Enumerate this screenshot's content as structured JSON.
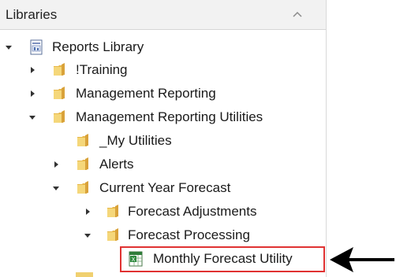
{
  "panel": {
    "title": "Libraries",
    "collapse_icon": "chevron-up-icon"
  },
  "tree": [
    {
      "label": "Reports Library",
      "icon": "library-icon",
      "expanded": true,
      "level": 0
    },
    {
      "label": "!Training",
      "icon": "folder-icon",
      "expanded": false,
      "level": 1
    },
    {
      "label": "Management Reporting",
      "icon": "folder-icon",
      "expanded": false,
      "level": 1
    },
    {
      "label": "Management Reporting Utilities",
      "icon": "folder-icon",
      "expanded": true,
      "level": 1
    },
    {
      "label": "_My Utilities",
      "icon": "folder-icon",
      "expanded": null,
      "level": 2
    },
    {
      "label": "Alerts",
      "icon": "folder-icon",
      "expanded": false,
      "level": 2
    },
    {
      "label": "Current Year Forecast",
      "icon": "folder-icon",
      "expanded": true,
      "level": 2
    },
    {
      "label": "Forecast Adjustments",
      "icon": "folder-icon",
      "expanded": false,
      "level": 3
    },
    {
      "label": "Forecast Processing",
      "icon": "folder-icon",
      "expanded": true,
      "level": 3
    },
    {
      "label": "Monthly Forecast Utility",
      "icon": "spreadsheet-icon",
      "expanded": null,
      "level": 4,
      "highlighted": true
    }
  ],
  "colors": {
    "highlight": "#e03232",
    "folder": "#e8b84a",
    "header_bg": "#f2f2f2"
  }
}
